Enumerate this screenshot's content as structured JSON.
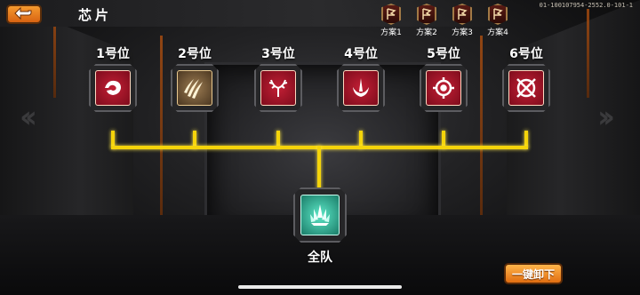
{
  "header": {
    "title": "芯片",
    "back_icon": "back-arrow-icon",
    "version": "01-100107954-2552.0-101-1"
  },
  "plans": [
    {
      "label": "方案1",
      "icon": "plan-flag-icon"
    },
    {
      "label": "方案2",
      "icon": "plan-flag-icon"
    },
    {
      "label": "方案3",
      "icon": "plan-flag-icon"
    },
    {
      "label": "方案4",
      "icon": "plan-flag-icon"
    }
  ],
  "slots": [
    {
      "label": "1号位",
      "icon": "dragon-emblem-icon",
      "color": "#a5142a"
    },
    {
      "label": "2号位",
      "icon": "claw-slash-icon",
      "color": "#7a5c3a"
    },
    {
      "label": "3号位",
      "icon": "antler-emblem-icon",
      "color": "#a5142a"
    },
    {
      "label": "4号位",
      "icon": "sword-emblem-icon",
      "color": "#a5142a"
    },
    {
      "label": "5号位",
      "icon": "target-ring-icon",
      "color": "#a5142a"
    },
    {
      "label": "6号位",
      "icon": "crossed-circle-icon",
      "color": "#a5142a"
    }
  ],
  "team": {
    "label": "全队",
    "icon": "crystal-cluster-icon",
    "color": "#3cc4a6"
  },
  "unload_all_label": "一键卸下",
  "colors": {
    "connector": "#f5d40a",
    "button_orange": "#f08a21"
  }
}
